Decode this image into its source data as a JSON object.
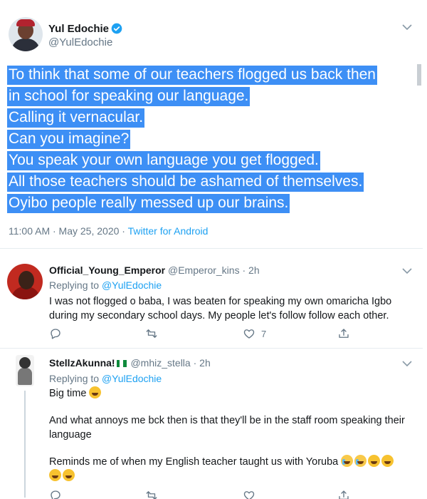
{
  "colors": {
    "accent": "#1da1f2",
    "selection": "#3d8ff5",
    "secondary_text": "#657786"
  },
  "main_tweet": {
    "author": {
      "name": "Yul Edochie",
      "handle": "@YulEdochie",
      "verified": true
    },
    "lines": [
      "To think that some of our teachers flogged us back then",
      "in school for speaking our language.",
      "Calling it vernacular.",
      "Can you imagine?",
      "You speak your own language you get flogged.",
      "All those teachers should be ashamed of themselves.",
      "Oyibo people really messed up our brains."
    ],
    "timestamp": "11:00 AM · May 25, 2020",
    "separator": " · ",
    "source": "Twitter for Android"
  },
  "replies": [
    {
      "name": "Official_Young_Emperor",
      "handle": "@Emperor_kins",
      "time": "2h",
      "replying_prefix": "Replying to ",
      "replying_to": "@YulEdochie",
      "text": "I was not flogged o baba, I was beaten for speaking my own omaricha Igbo during my secondary school days. My people let's follow follow each other.",
      "like_count": "7",
      "icons": [
        "reply-icon",
        "retweet-icon",
        "like-icon",
        "share-icon"
      ]
    },
    {
      "name": "StellzAkunna!",
      "flag": "nigeria-flag",
      "handle": "@mhiz_stella",
      "time": "2h",
      "replying_prefix": "Replying to ",
      "replying_to": "@YulEdochie",
      "paragraphs": [
        "Big time",
        "And what annoys me bck then is that they'll be in the staff room speaking their language",
        "Reminds me of when my English teacher taught us with Yoruba"
      ],
      "emojis": [
        "rolling-laughing",
        "crying",
        "crying",
        "rolling-laughing",
        "rolling-laughing",
        "rolling-laughing",
        "rolling-laughing"
      ]
    }
  ]
}
